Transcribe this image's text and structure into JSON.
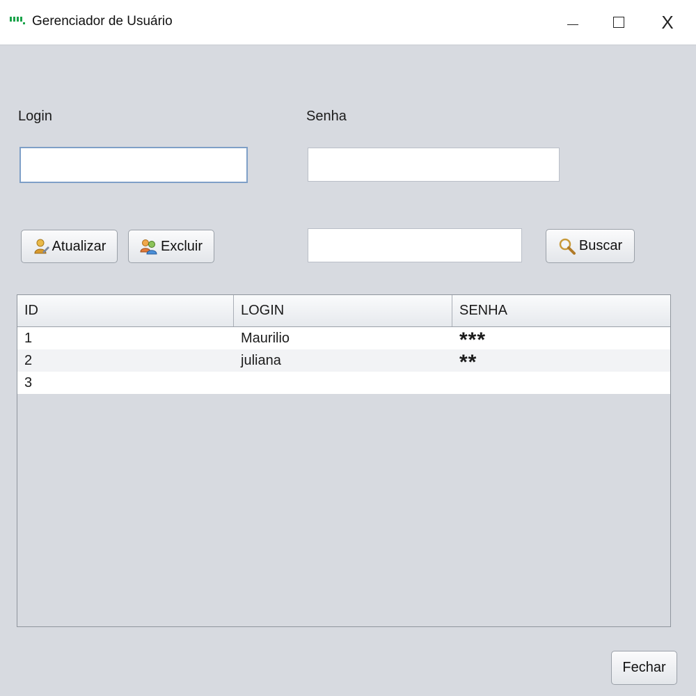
{
  "window": {
    "title": "Gerenciador de Usuário",
    "minimize_glyph": "–",
    "close_glyph": "X",
    "accent_color": "#1aa34a"
  },
  "form": {
    "login_label": "Login",
    "login_value": "",
    "senha_label": "Senha",
    "senha_value": "",
    "search_value": ""
  },
  "buttons": {
    "atualizar": {
      "label": "Atualizar",
      "icon": "user-edit-icon"
    },
    "excluir": {
      "label": "Excluir",
      "icon": "users-delete-icon"
    },
    "buscar": {
      "label": "Buscar",
      "icon": "magnifier-icon"
    },
    "fechar": {
      "label": "Fechar"
    }
  },
  "table": {
    "columns": [
      "ID",
      "LOGIN",
      "SENHA"
    ],
    "rows": [
      {
        "id": "1",
        "login": "Maurilio",
        "senha": "***"
      },
      {
        "id": "2",
        "login": "juliana",
        "senha": "**"
      },
      {
        "id": "3",
        "login": "",
        "senha": ""
      }
    ]
  }
}
